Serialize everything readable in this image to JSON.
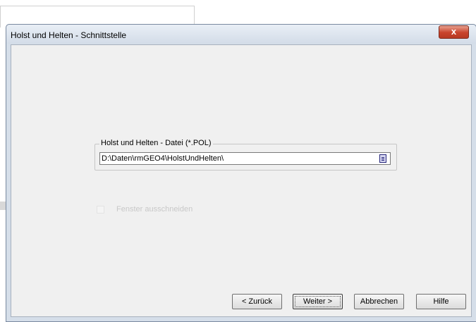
{
  "window": {
    "title": "Holst und Helten - Schnittstelle",
    "close_symbol": "x"
  },
  "file_group": {
    "legend": "Holst und Helten - Datei (*.POL)",
    "path_value": "D:\\Daten\\rmGEO4\\HolstUndHelten\\",
    "browse_icon": "file-browse-icon"
  },
  "option": {
    "label": "Fenster ausschneiden",
    "checked": false,
    "enabled": false
  },
  "buttons": {
    "back": "< Zurück",
    "next": "Weiter >",
    "cancel": "Abbrechen",
    "help": "Hilfe"
  }
}
